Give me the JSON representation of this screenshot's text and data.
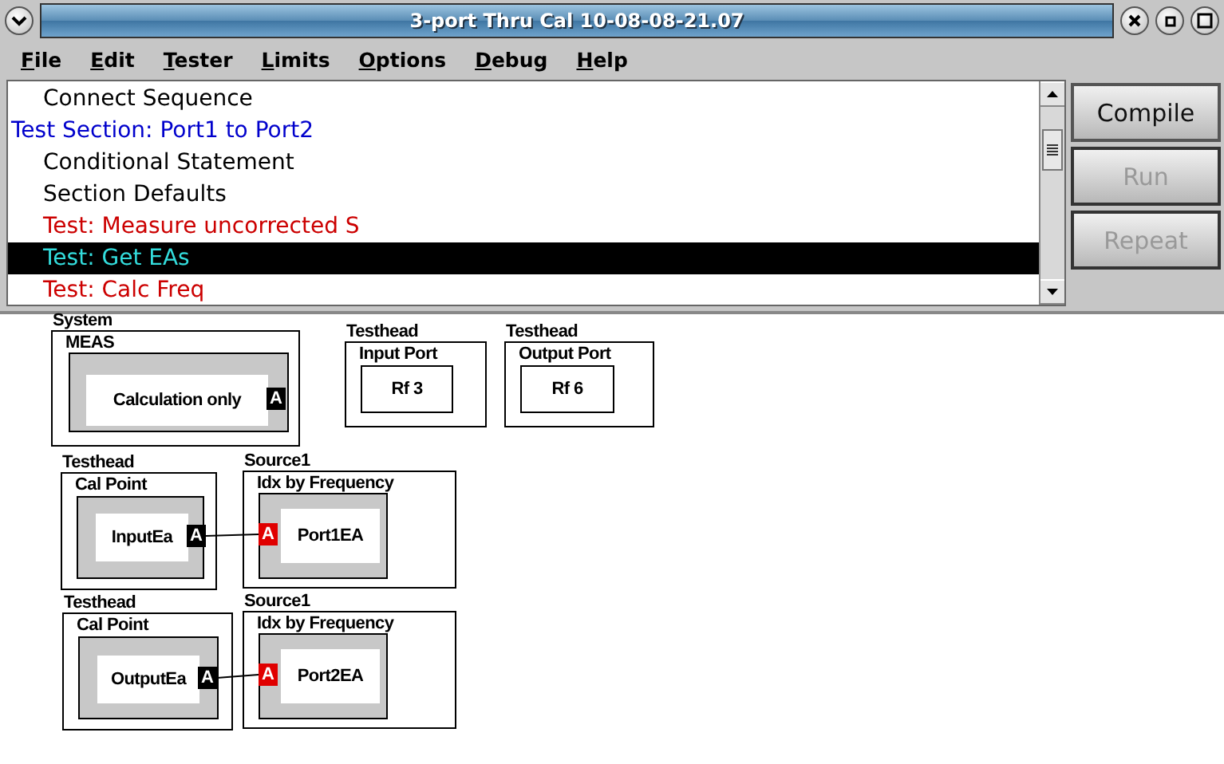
{
  "window": {
    "title": "3-port Thru Cal 10-08-08-21.07"
  },
  "menu": [
    "File",
    "Edit",
    "Tester",
    "Limits",
    "Options",
    "Debug",
    "Help"
  ],
  "sequence": {
    "items": [
      {
        "text": "Connect Sequence",
        "kind": "step",
        "color": "#000000",
        "selected": false
      },
      {
        "text": "Test Section: Port1 to Port2",
        "kind": "section",
        "color": "#0000cc",
        "selected": false
      },
      {
        "text": "Conditional Statement",
        "kind": "step",
        "color": "#000000",
        "selected": false
      },
      {
        "text": "Section Defaults",
        "kind": "step",
        "color": "#000000",
        "selected": false
      },
      {
        "text": "Test: Measure uncorrected S",
        "kind": "step",
        "color": "#cc0000",
        "selected": false
      },
      {
        "text": "Test: Get EAs",
        "kind": "step",
        "color": "#33dddd",
        "selected": true
      },
      {
        "text": "Test: Calc Freq",
        "kind": "step",
        "color": "#cc0000",
        "selected": false
      }
    ]
  },
  "buttons": [
    {
      "label": "Compile",
      "disabled": false
    },
    {
      "label": "Run",
      "disabled": true
    },
    {
      "label": "Repeat",
      "disabled": true
    }
  ],
  "diagram": {
    "blocks": [
      {
        "group": "System",
        "title": "MEAS",
        "label": "Calculation only",
        "kind": "process",
        "pin": {
          "label": "A",
          "color": "#000000",
          "kind": "output"
        }
      },
      {
        "group": "Testhead",
        "title": "Input Port",
        "label": "Rf 3",
        "kind": "port"
      },
      {
        "group": "Testhead",
        "title": "Output Port",
        "label": "Rf 6",
        "kind": "port"
      },
      {
        "group": "Testhead",
        "title": "Cal Point",
        "label": "InputEa",
        "kind": "process",
        "pin": {
          "label": "A",
          "color": "#000000",
          "kind": "output"
        }
      },
      {
        "group": "Source1",
        "title": "Idx by Frequency",
        "label": "Port1EA",
        "kind": "process",
        "pin": {
          "label": "A",
          "color": "#e00000",
          "kind": "input"
        }
      },
      {
        "group": "Testhead",
        "title": "Cal Point",
        "label": "OutputEa",
        "kind": "process",
        "pin": {
          "label": "A",
          "color": "#000000",
          "kind": "output"
        }
      },
      {
        "group": "Source1",
        "title": "Idx by Frequency",
        "label": "Port2EA",
        "kind": "process",
        "pin": {
          "label": "A",
          "color": "#e00000",
          "kind": "input"
        }
      }
    ]
  }
}
